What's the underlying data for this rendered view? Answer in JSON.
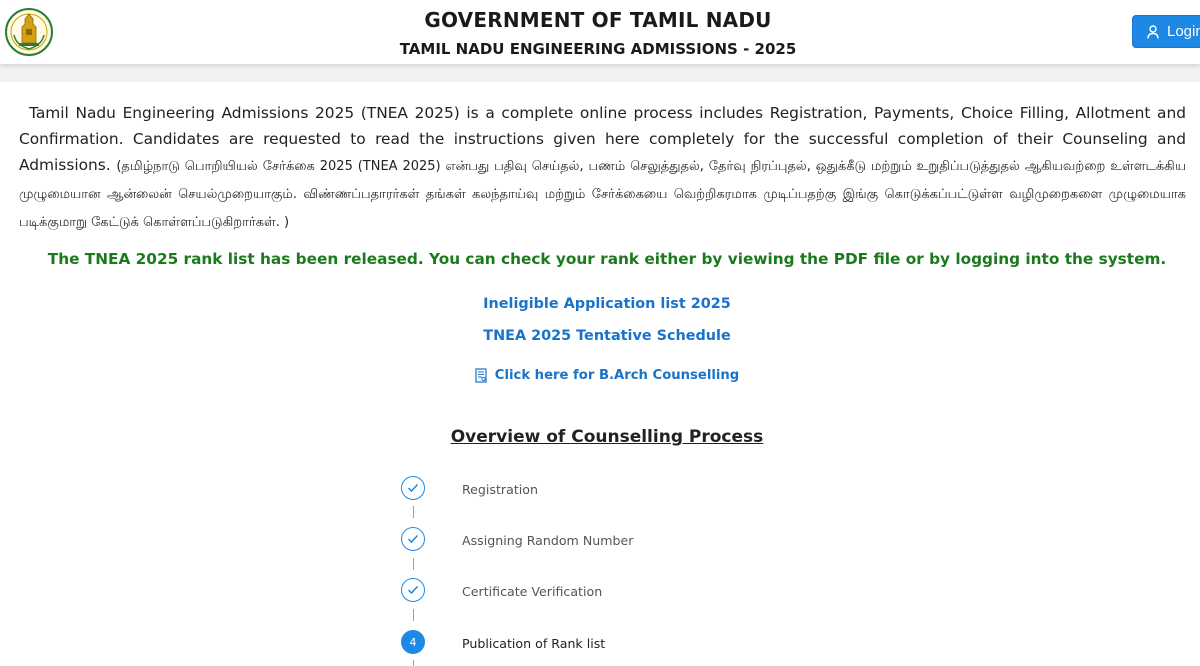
{
  "header": {
    "title": "GOVERNMENT OF TAMIL NADU",
    "subtitle": "TAMIL NADU ENGINEERING ADMISSIONS - 2025",
    "emblem_icon": "tamil-nadu-emblem",
    "login_label": "Login"
  },
  "intro": {
    "english": "Tamil Nadu Engineering Admissions 2025 (TNEA 2025) is a complete online process includes Registration, Payments, Choice Filling, Allotment and Confirmation. Candidates are requested to read the instructions given here completely for the successful completion of their Counseling and Admissions.",
    "tamil": "(தமிழ்நாடு பொறியியல் சேர்க்கை 2025 (TNEA 2025) என்பது பதிவு செய்தல், பணம் செலுத்துதல், தேர்வு நிரப்புதல், ஒதுக்கீடு மற்றும் உறுதிப்படுத்துதல் ஆகியவற்றை உள்ளடக்கிய முழுமையான ஆன்லைன் செயல்முறையாகும். விண்ணப்பதாரர்கள் தங்கள் கலந்தாய்வு மற்றும் சேர்க்கையை வெற்றிகரமாக முடிப்பதற்கு இங்கு கொடுக்கப்பட்டுள்ள வழிமுறைகளை முழுமையாக படிக்குமாறு கேட்டுக் கொள்ளப்படுகிறார்கள். )"
  },
  "notice": "The TNEA 2025 rank list has been released. You can check your rank either by viewing the PDF file or by logging into the system.",
  "links": {
    "ineligible": "Ineligible Application list 2025",
    "schedule": "TNEA 2025 Tentative Schedule",
    "barch": "Click here for B.Arch Counselling",
    "barch_icon": "document-icon"
  },
  "overview": {
    "title": "Overview of Counselling Process",
    "steps": [
      {
        "label": "Registration",
        "status": "done"
      },
      {
        "label": "Assigning Random Number",
        "status": "done"
      },
      {
        "label": "Certificate Verification",
        "status": "done"
      },
      {
        "label": "Publication of Rank list",
        "status": "current",
        "number": "4"
      }
    ]
  },
  "colors": {
    "primary": "#1e88e5",
    "notice_green": "#1b7a1b",
    "link_blue": "#1a73c9"
  }
}
